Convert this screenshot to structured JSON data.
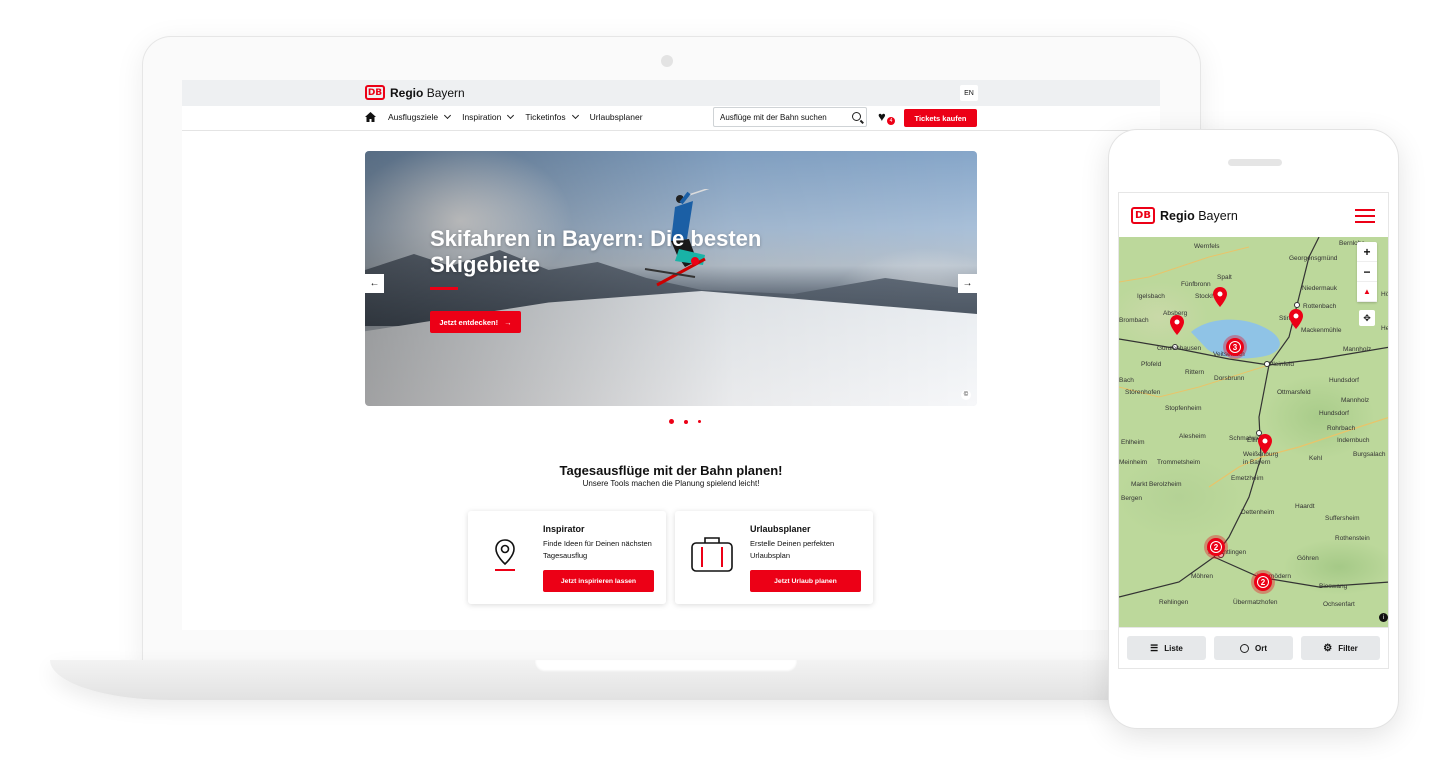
{
  "laptop": {
    "brand": {
      "badge": "DB",
      "name_bold": "Regio",
      "name_regular": "Bayern"
    },
    "lang": "EN",
    "nav": [
      {
        "label": "Ausflugsziele"
      },
      {
        "label": "Inspiration"
      },
      {
        "label": "Ticketinfos"
      },
      {
        "label": "Urlaubsplaner"
      }
    ],
    "search_placeholder": "Ausflüge mit der Bahn suchen",
    "favorites_count": "4",
    "tickets_button": "Tickets kaufen",
    "hero": {
      "title": "Skifahren in Bayern: Die besten Skigebiete",
      "cta": "Jetzt entdecken!",
      "prev": "←",
      "next": "→",
      "info": "©"
    },
    "section": {
      "title": "Tagesausflüge mit der Bahn planen!",
      "subtitle": "Unsere Tools machen die Planung spielend leicht!"
    },
    "cards": [
      {
        "title": "Inspirator",
        "text": "Finde Ideen für Deinen nächsten Tagesausflug",
        "button": "Jetzt inspirieren lassen"
      },
      {
        "title": "Urlaubsplaner",
        "text": "Erstelle Deinen perfekten Urlaubsplan",
        "button": "Jetzt Urlaub planen"
      }
    ]
  },
  "phone": {
    "brand": {
      "badge": "DB",
      "name_bold": "Regio",
      "name_regular": "Bayern"
    },
    "map_labels": [
      "Wernfels",
      "Bernlohe",
      "Georgensgmünd",
      "Spalt",
      "Fünfbronn",
      "Niedermauk",
      "Igelsbach",
      "Stockheim",
      "Rottenbach",
      "Absberg",
      "Stirn",
      "Mackenmühle",
      "Brombach",
      "Gunzenhausen",
      "Veitserlach",
      "Pleinfeld",
      "Mannholz",
      "Pfofeld",
      "Rittern",
      "Dorsbrunn",
      "Ottmarsfeld",
      "Hundsdorf",
      "Störenhofen",
      "Stopfenheim",
      "Ellingen",
      "Rohrbach",
      "Indernbuch",
      "Ehlheim",
      "Alesheim",
      "Schmalwiesen",
      "Weißenburg in Bayern",
      "Kehl",
      "Burgsalach",
      "Meinheim",
      "Trommetsheim",
      "Emetzheim",
      "Markt Berolzheim",
      "Haardt",
      "Dettenheim",
      "Suffersheim",
      "Rothenstein",
      "Treuchtlingen",
      "Göhren",
      "Möhren",
      "Bieswang",
      "Rehlingen",
      "Übermatzhofen",
      "Ochsenfart",
      "Heumödern",
      "Hundsdorf",
      "Mannholz",
      "Bach",
      "Bergen",
      "Hö",
      "He"
    ],
    "clusters": [
      "3",
      "2",
      "2"
    ],
    "zoom_in": "+",
    "zoom_out": "−",
    "map_info": "i",
    "bottom_bar": [
      {
        "label": "Liste",
        "icon": "list-icon"
      },
      {
        "label": "Ort",
        "icon": "search-icon"
      },
      {
        "label": "Filter",
        "icon": "filter-icon"
      }
    ]
  },
  "colors": {
    "accent": "#ec0016",
    "map_green": "#bcd89b",
    "lake": "#8fc3e6"
  }
}
